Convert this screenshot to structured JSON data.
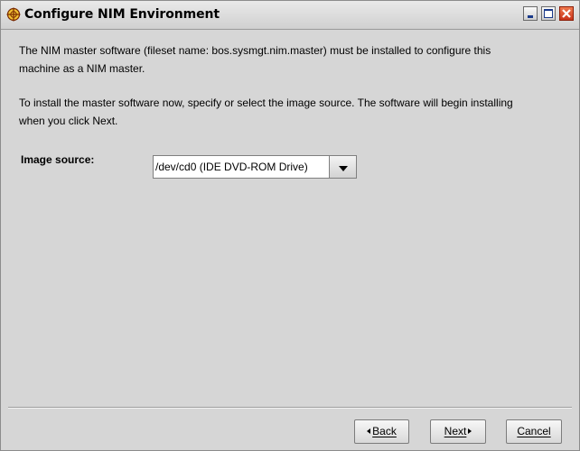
{
  "window": {
    "title": "Configure NIM Environment",
    "controls": [
      "minimize-icon",
      "maximize-icon",
      "close-icon"
    ]
  },
  "content": {
    "paragraph1": "The NIM master software (fileset name:  bos.sysmgt.nim.master) must be installed to configure this machine as a NIM master.",
    "paragraph2": "To install the master software now, specify or select the image source.  The software will begin installing when you click Next.",
    "image_source": {
      "label": "Image source:",
      "value": "/dev/cd0 (IDE DVD-ROM Drive)"
    }
  },
  "footer": {
    "back_label": "Back",
    "next_label": "Next",
    "cancel_label": "Cancel"
  }
}
